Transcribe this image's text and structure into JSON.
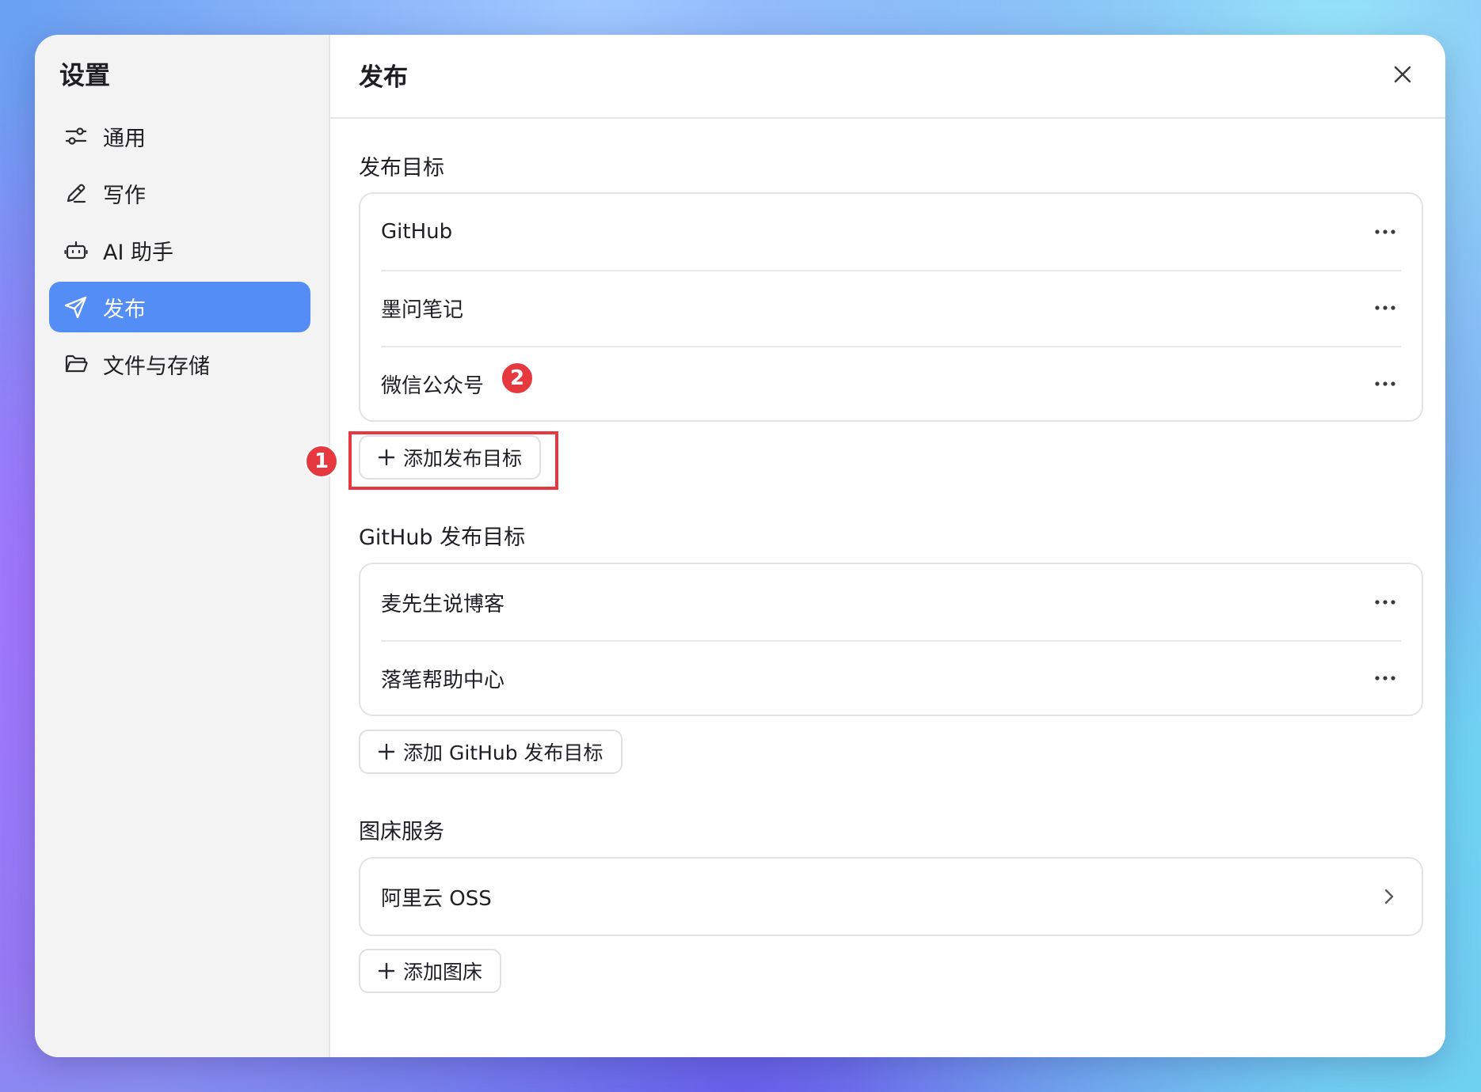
{
  "sidebar": {
    "title": "设置",
    "items": [
      {
        "label": "通用",
        "icon": "sliders-icon",
        "active": false
      },
      {
        "label": "写作",
        "icon": "pen-icon",
        "active": false
      },
      {
        "label": "AI 助手",
        "icon": "robot-icon",
        "active": false
      },
      {
        "label": "发布",
        "icon": "send-icon",
        "active": true
      },
      {
        "label": "文件与存储",
        "icon": "folder-icon",
        "active": false
      }
    ]
  },
  "main": {
    "title": "发布",
    "publish_targets": {
      "title": "发布目标",
      "items": [
        "GitHub",
        "墨问笔记",
        "微信公众号"
      ],
      "add_label": "添加发布目标"
    },
    "github_targets": {
      "title": "GitHub 发布目标",
      "items": [
        "麦先生说博客",
        "落笔帮助中心"
      ],
      "add_label": "添加 GitHub 发布目标"
    },
    "image_hosting": {
      "title": "图床服务",
      "items": [
        "阿里云 OSS"
      ],
      "add_label": "添加图床"
    }
  },
  "annotations": {
    "badge_1": "1",
    "badge_2": "2",
    "color": "#e5393f"
  },
  "colors": {
    "accent": "#548df5"
  }
}
